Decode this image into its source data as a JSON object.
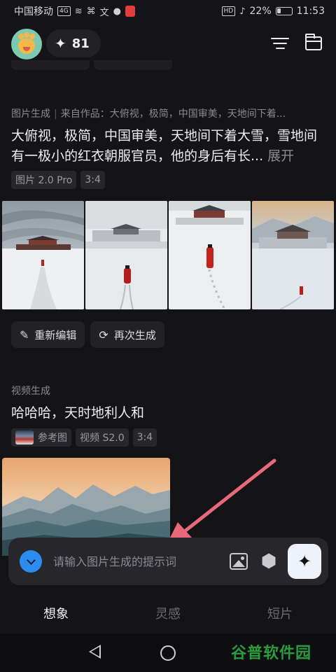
{
  "status_bar": {
    "carrier": "中国移动",
    "network": "4G",
    "hd": "HD",
    "battery": "22%",
    "time": "11:53"
  },
  "header": {
    "credits": "81",
    "spark_icon": "✦"
  },
  "image_section": {
    "type_label": "图片生成",
    "source_label": "来自作品：大俯视，极简，中国审美，天地间下着...",
    "prompt": "大俯视，极简，中国审美，天地间下着大雪，雪地间有一极小的红衣朝服官员，他的身后有长...",
    "expand_label": "展开",
    "tags": [
      "图片 2.0 Pro",
      "3:4"
    ],
    "actions": {
      "reedit_label": "重新编辑",
      "regenerate_label": "再次生成"
    }
  },
  "video_section": {
    "type_label": "视频生成",
    "prompt": "哈哈哈，天时地利人和",
    "tags": [
      "参考图",
      "视频 S2.0",
      "3:4"
    ]
  },
  "input_bar": {
    "placeholder": "请输入图片生成的提示词"
  },
  "bottom_nav": {
    "tabs": [
      "想象",
      "灵感",
      "短片"
    ],
    "active_index": 0
  },
  "watermark": {
    "text_green": "谷普",
    "text_dark": "软件园"
  },
  "colors": {
    "background": "#141416",
    "accent_blue": "#2d8cf0",
    "annotation_arrow": "#e8697a"
  }
}
